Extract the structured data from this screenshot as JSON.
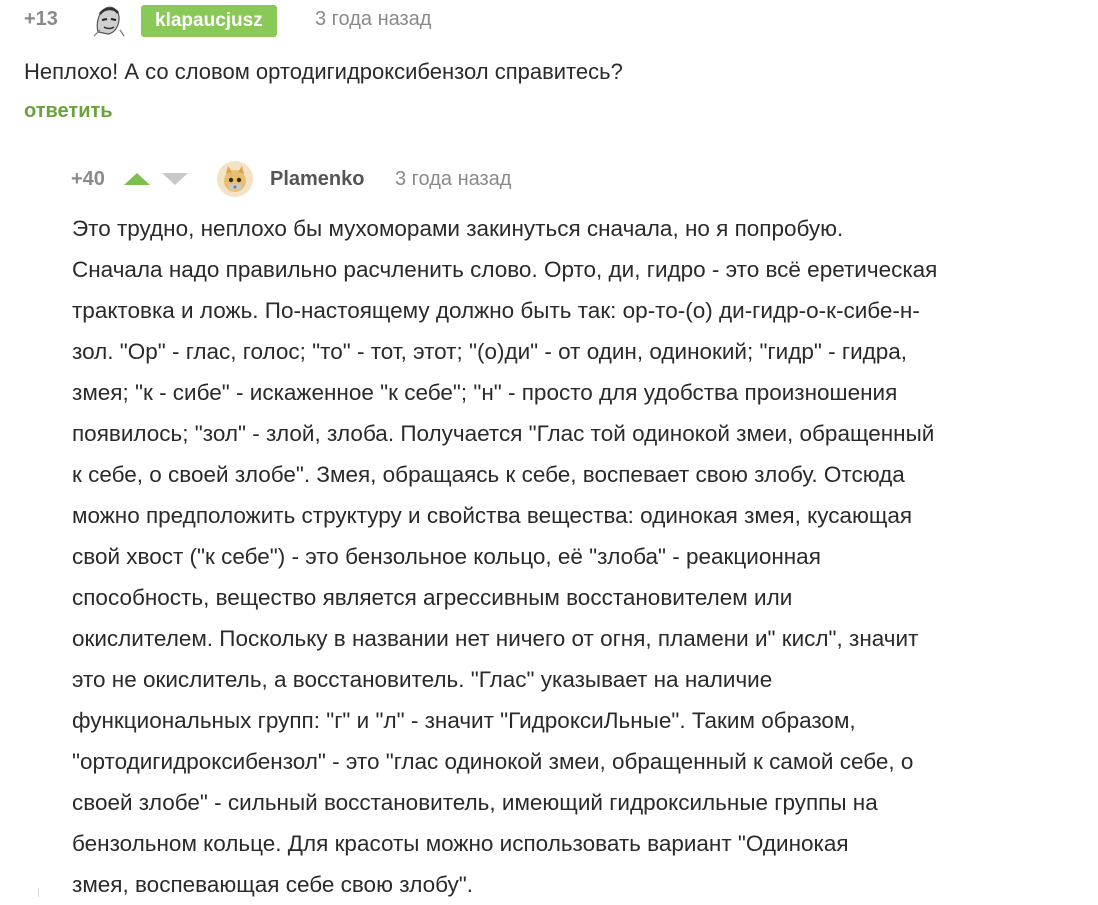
{
  "comments": [
    {
      "rating": "+13",
      "author": "klapaucjusz",
      "time": "3 года назад",
      "text": "Неплохо! А со словом ортодигидроксибензол справитесь?",
      "reply_label": "ответить"
    }
  ],
  "reply": {
    "rating": "+40",
    "author": "Plamenko",
    "time": "3 года назад",
    "lines": [
      "Это трудно, неплохо бы мухоморами закинуться сначала, но я попробую.",
      "Сначала надо правильно расчленить слово. Орто, ди, гидро - это всё еретическая",
      "трактовка и ложь. По-настоящему должно быть так: ор-то-(о) ди-гидр-о-к-сибе-н-",
      "зол. \"Ор\" - глас, голос; \"то\" - тот, этот; \"(о)ди\" - от один, одинокий; \"гидр\" - гидра,",
      "змея; \"к - сибе\" - искаженное \"к себе\"; \"н\" - просто для удобства произношения",
      "появилось; \"зол\" - злой, злоба. Получается \"Глас той одинокой змеи, обращенный",
      "к себе, о своей злобе\". Змея, обращаясь к себе, воспевает свою злобу. Отсюда",
      "можно предположить структуру и свойства вещества: одинокая змея, кусающая",
      "свой хвост (\"к себе\") - это бензольное кольцо, её \"злоба\" - реакционная",
      "способность, вещество является агрессивным восстановителем или",
      "окислителем. Поскольку в названии нет ничего от огня, пламени и\" кисл\", значит",
      "это не окислитель, а восстановитель. \"Глас\" указывает на наличие",
      "функциональных групп: \"г\" и \"л\" - значит \"ГидроксиЛьные\". Таким образом,",
      "\"ортодигидроксибензол\" - это \"глас одинокой змеи, обращенный к самой себе,  о",
      "своей злобе\" - сильный восстановитель, имеющий гидроксильные группы на",
      "бензольном кольце. Для красоты можно использовать вариант   \"Одинокая",
      "змея, воспевающая себе свою злобу\"."
    ]
  },
  "colors": {
    "accent_green": "#8ac858",
    "link_green": "#6aa33c",
    "muted_gray": "#8a8a8a",
    "text": "#2a2a2a"
  },
  "icons": {
    "vote_up": "triangle-up-icon",
    "vote_down": "triangle-down-icon",
    "avatar_top": "avatar-sketch-icon",
    "avatar_nested": "avatar-cat-icon"
  }
}
